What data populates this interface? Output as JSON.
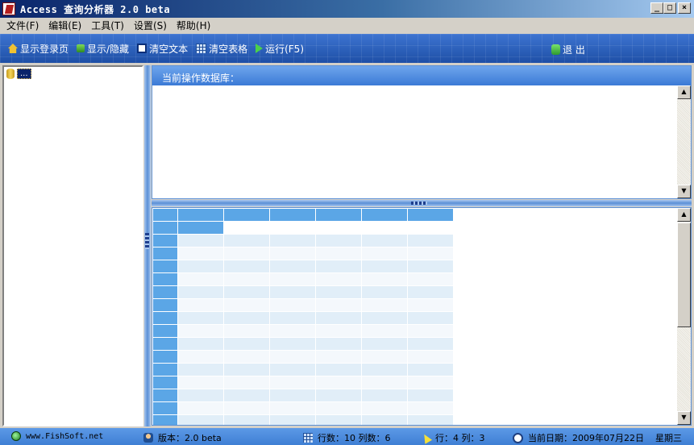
{
  "window": {
    "title": "Access 查询分析器 2.0 beta",
    "buttons": {
      "minimize": "_",
      "maximize": "□",
      "close": "×"
    }
  },
  "menu": [
    "文件(F)",
    "编辑(E)",
    "工具(T)",
    "设置(S)",
    "帮助(H)"
  ],
  "toolbar": {
    "show_login": "显示登录页",
    "show_hide": "显示/隐藏",
    "clear_text": "清空文本",
    "clear_table": "清空表格",
    "run": "运行(F5)",
    "exit": "退 出"
  },
  "tree": {
    "root_label": "..."
  },
  "query_panel": {
    "header": "当前操作数据库："
  },
  "scrollbar": {
    "up": "▲",
    "down": "▼"
  },
  "grid": {
    "columns": 6,
    "rows": 16,
    "selected_cell": [
      1,
      1
    ]
  },
  "status": {
    "website": "www.FishSoft.net",
    "version": "版本：2.0 beta",
    "counts": "行数：10  列数：6",
    "cursor": "行：4  列：3",
    "date": "当前日期：2009年07月22日",
    "weekday": "星期三"
  },
  "colors": {
    "accent_blue": "#3b7ad6",
    "grid_header": "#5ba6e6",
    "grid_cell": "#e1eef8"
  }
}
